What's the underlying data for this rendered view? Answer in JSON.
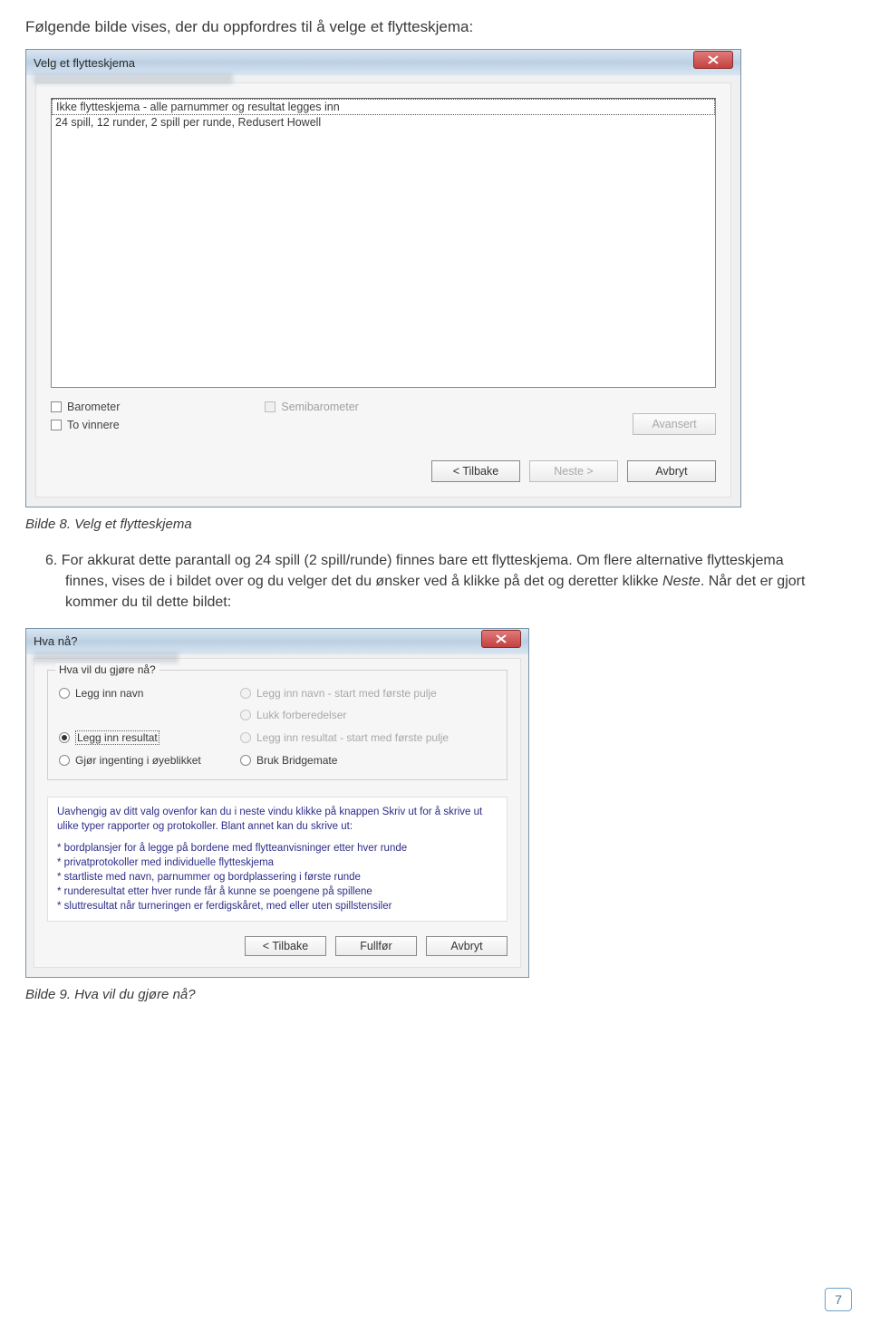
{
  "intro_text": "Følgende bilde vises, der du oppfordres til å velge et flytteskjema:",
  "dialog1": {
    "title": "Velg et flytteskjema",
    "list_items": [
      "Ikke flytteskjema - alle parnummer og resultat legges inn",
      "24 spill, 12 runder, 2 spill per runde, Redusert Howell"
    ],
    "chk_barometer": "Barometer",
    "chk_semibarometer": "Semibarometer",
    "chk_tovinnere": "To vinnere",
    "btn_avansert": "Avansert",
    "btn_tilbake": "< Tilbake",
    "btn_neste": "Neste >",
    "btn_avbryt": "Avbryt"
  },
  "caption1": "Bilde 8. Velg et flytteskjema",
  "para_num": "6.",
  "para_text_a": "For akkurat dette parantall og 24 spill (2 spill/runde) finnes bare ett flytteskjema. Om flere alternative flytteskjema finnes, vises de i bildet over og du velger det du ønsker ved å klikke på det og deretter klikke ",
  "para_text_italic": "Neste",
  "para_text_b": ". Når det er gjort kommer du til dette bildet:",
  "dialog2": {
    "title": "Hva nå?",
    "legend": "Hva vil du gjøre nå?",
    "r_legg_navn": "Legg inn navn",
    "r_legg_navn_start": "Legg inn navn - start med første pulje",
    "r_lukk": "Lukk forberedelser",
    "r_legg_res": "Legg inn resultat",
    "r_legg_res_start": "Legg inn resultat - start med første pulje",
    "r_gjor_ingenting": "Gjør ingenting i øyeblikket",
    "r_bruk_bm": "Bruk Bridgemate",
    "info_para": "Uavhengig av ditt valg ovenfor kan du i neste vindu klikke på knappen Skriv ut for å skrive ut ulike typer rapporter og protokoller. Blant annet kan du skrive ut:",
    "bullets": [
      "* bordplansjer for å legge på bordene med flytteanvisninger etter hver runde",
      "* privatprotokoller med individuelle flytteskjema",
      "* startliste med navn, parnummer og bordplassering i første runde",
      "* runderesultat etter hver runde får å kunne se poengene på spillene",
      "* sluttresultat når turneringen er ferdigskåret, med eller uten spillstensiler"
    ],
    "btn_tilbake": "< Tilbake",
    "btn_fullfor": "Fullfør",
    "btn_avbryt": "Avbryt"
  },
  "caption2": "Bilde 9. Hva vil du gjøre nå?",
  "page_number": "7"
}
